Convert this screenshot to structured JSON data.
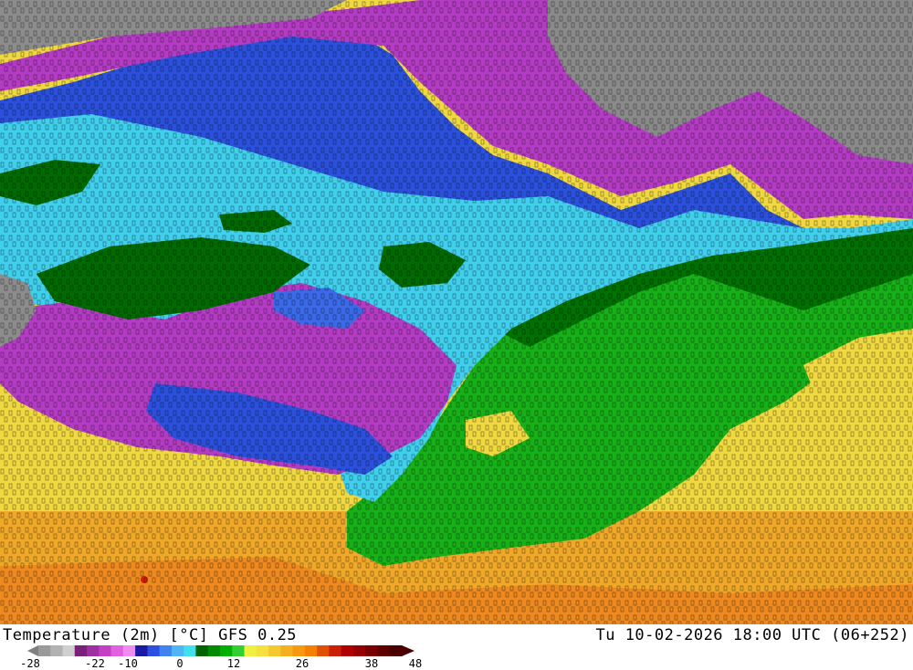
{
  "title": {
    "left": "Temperature (2m) [°C] GFS 0.25",
    "right": "Tu 10-02-2026 18:00 UTC (06+252)"
  },
  "legend": {
    "ticks": [
      "-28",
      "-22",
      "-10",
      "0",
      "12",
      "26",
      "38",
      "48"
    ],
    "colors": [
      "#9a9a9a",
      "#b2b2b2",
      "#cfcfcf",
      "#7a1f7a",
      "#9e2fa0",
      "#c43fc4",
      "#e060e0",
      "#f08cf0",
      "#1a1aa0",
      "#2b4fe0",
      "#3f82f0",
      "#4fb5f5",
      "#40e0f0",
      "#006400",
      "#008a00",
      "#00b000",
      "#30d030",
      "#f0f040",
      "#f5e040",
      "#f5c830",
      "#f5b020",
      "#f59a10",
      "#f58000",
      "#e05000",
      "#c82000",
      "#b00000",
      "#960000",
      "#7a0000",
      "#5e0000",
      "#4a0000"
    ]
  },
  "palette": {
    "cold_grey": "#8a8a8a",
    "violet": "#b030c0",
    "blue": "#3050e0",
    "cyan": "#40d8f0",
    "dark_green": "#006400",
    "green": "#10b010",
    "yellow": "#f0e040",
    "orange": "#f0a020"
  }
}
